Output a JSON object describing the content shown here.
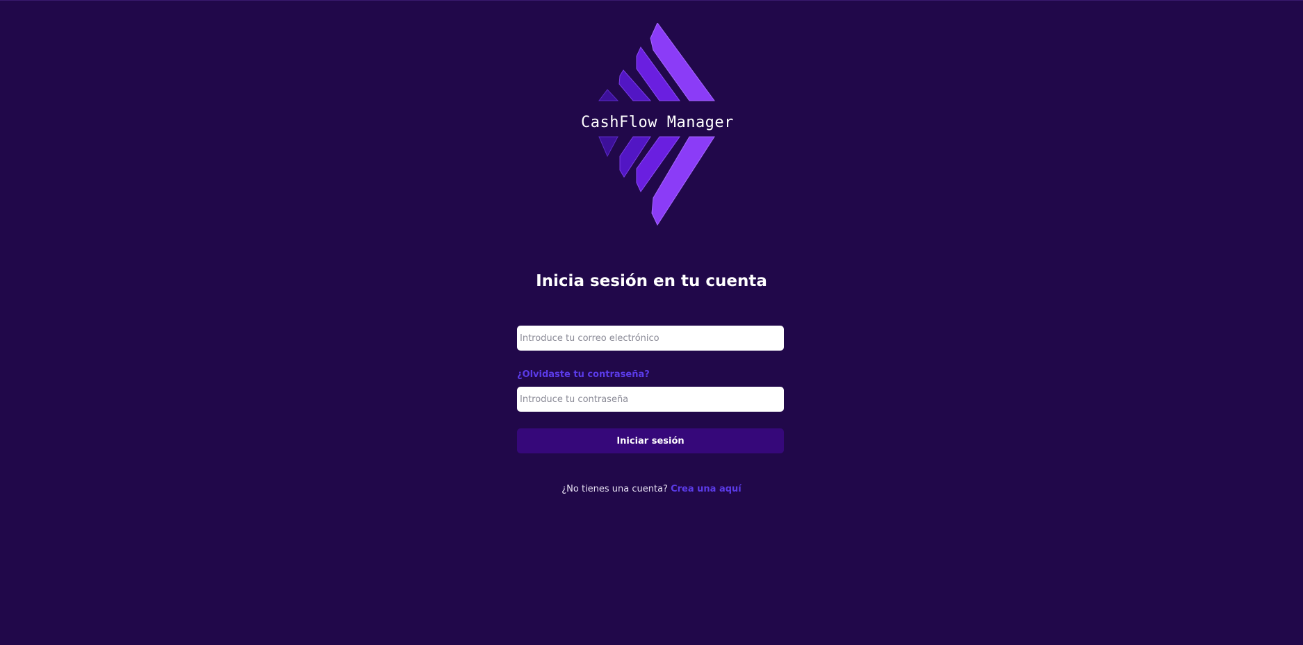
{
  "brand": {
    "name": "CashFlow Manager",
    "colors": {
      "background": "#21084a",
      "stripe_light": "#8b3cf7",
      "stripe_mid": "#6a1fe0",
      "stripe_dark": "#5216c4",
      "stripe_darkest": "#3d109a",
      "link": "#5b3be8",
      "button": "#36087a"
    }
  },
  "login": {
    "title": "Inicia sesión en tu cuenta",
    "email_placeholder": "Introduce tu correo electrónico",
    "email_value": "",
    "forgot_password": "¿Olvidaste tu contraseña?",
    "password_placeholder": "Introduce tu contraseña",
    "password_value": "",
    "submit_label": "Iniciar sesión"
  },
  "signup": {
    "prompt": "¿No tienes una cuenta?",
    "link_label": "Crea una aquí"
  }
}
